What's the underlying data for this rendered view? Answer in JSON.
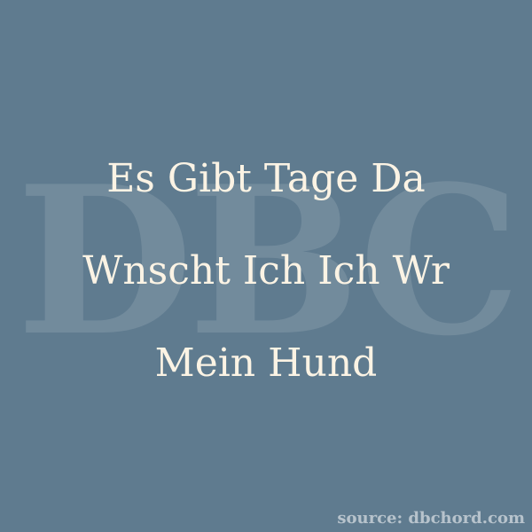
{
  "watermark": "DBC",
  "quote": {
    "lines": [
      "Es Gibt Tage Da",
      "Wnscht Ich Ich Wr",
      "Mein Hund"
    ]
  },
  "source": "source: dbchord.com",
  "colors": {
    "background": "#5f7b8f",
    "text": "#fbf3e4",
    "watermark": "rgba(255,255,255,0.12)"
  }
}
